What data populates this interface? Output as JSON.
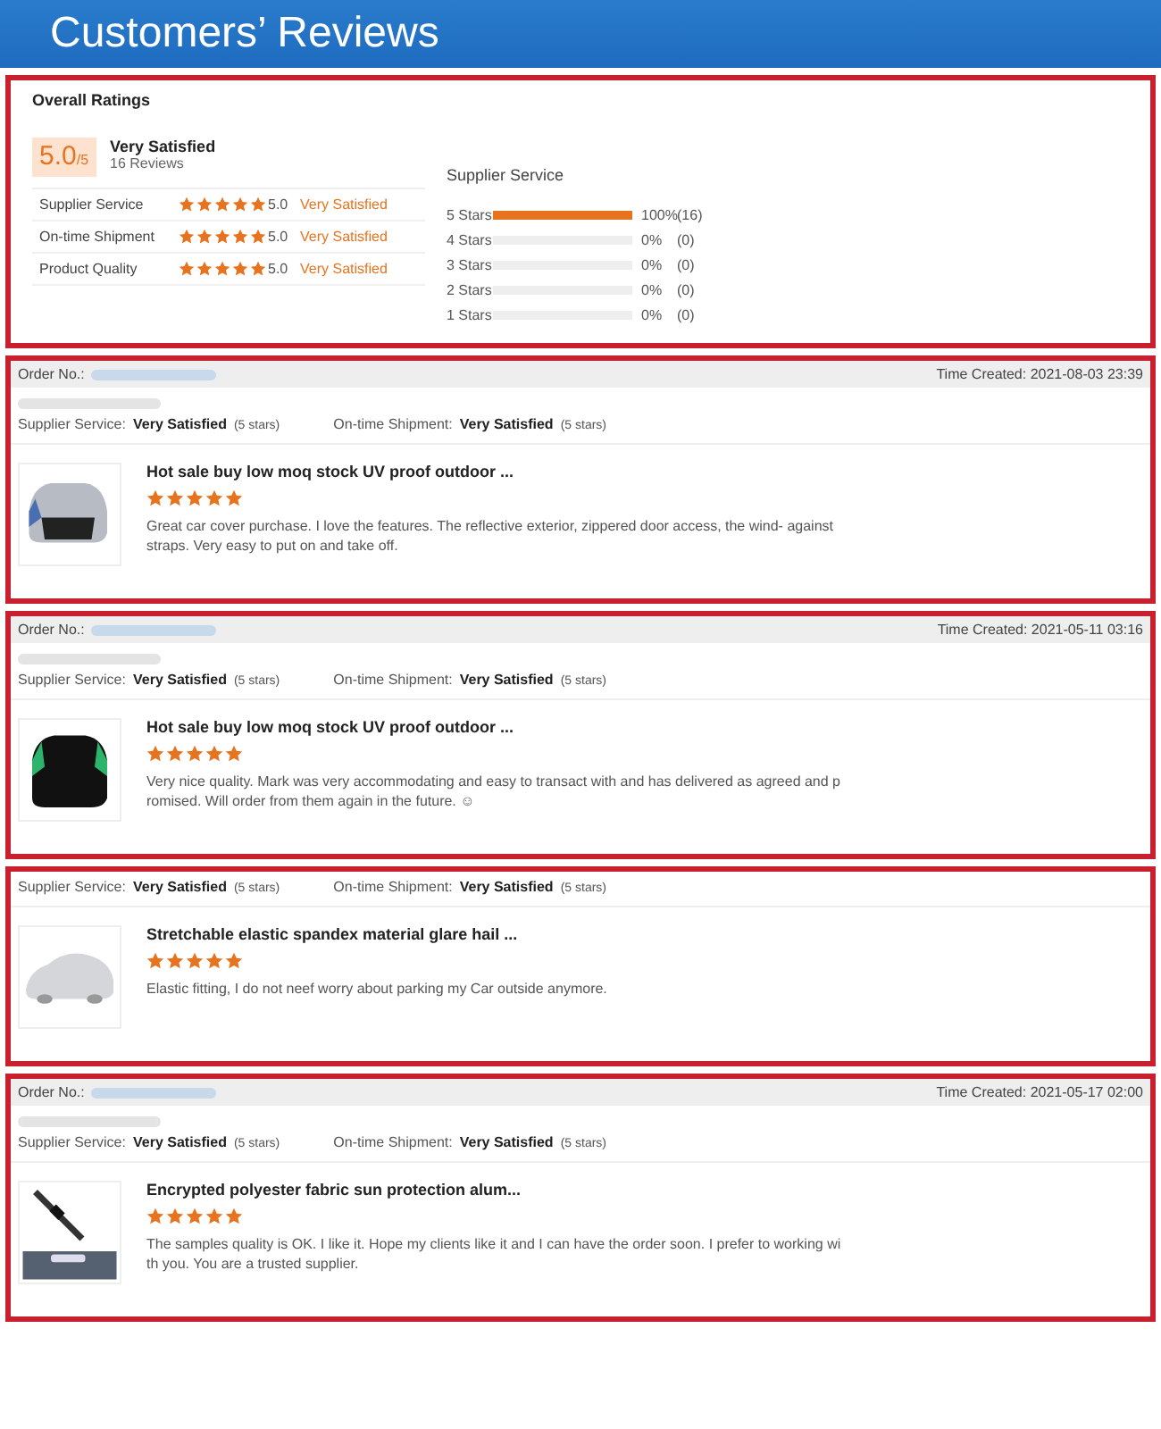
{
  "banner": {
    "title": "Customers’ Reviews"
  },
  "overall": {
    "title": "Overall Ratings",
    "score": "5.0",
    "score_suffix": "/5",
    "verdict": "Very Satisfied",
    "reviews": "16 Reviews",
    "ratings": [
      {
        "label": "Supplier Service",
        "stars": 5,
        "score": "5.0",
        "verdict": "Very Satisfied"
      },
      {
        "label": "On-time Shipment",
        "stars": 5,
        "score": "5.0",
        "verdict": "Very Satisfied"
      },
      {
        "label": "Product Quality",
        "stars": 5,
        "score": "5.0",
        "verdict": "Very Satisfied"
      }
    ],
    "distribution_title": "Supplier Service",
    "distribution": [
      {
        "label": "5 Stars",
        "level": 1,
        "percent": "100%",
        "count": "(16)"
      },
      {
        "label": "4 Stars",
        "level": 0,
        "percent": "0%",
        "count": "(0)"
      },
      {
        "label": "3 Stars",
        "level": 0,
        "percent": "0%",
        "count": "(0)"
      },
      {
        "label": "2 Stars",
        "level": 0,
        "percent": "0%",
        "count": "(0)"
      },
      {
        "label": "1 Stars",
        "level": 0,
        "percent": "0%",
        "count": "(0)"
      }
    ]
  },
  "reviews": [
    {
      "order_label": "Order No.:",
      "time_created": "Time Created: 2021-08-03 23:39",
      "ratings": [
        {
          "label": "Supplier Service:",
          "value": "Very Satisfied",
          "stars_text": "(5 stars)"
        },
        {
          "label": "On-time Shipment:",
          "value": "Very Satisfied",
          "stars_text": "(5 stars)"
        }
      ],
      "product": "Hot sale buy low moq stock UV proof outdoor ...",
      "thumbnail": {
        "kind": "grey-cover"
      },
      "stars": 5,
      "comment": "Great car cover purchase. I love the features. The reflective exterior, zippered door access, the wind- against straps. Very easy to put on and take off."
    },
    {
      "order_label": "Order No.:",
      "time_created": "Time Created: 2021-05-11 03:16",
      "ratings": [
        {
          "label": "Supplier Service:",
          "value": "Very Satisfied",
          "stars_text": "(5 stars)"
        },
        {
          "label": "On-time Shipment:",
          "value": "Very Satisfied",
          "stars_text": "(5 stars)"
        }
      ],
      "product": "Hot sale buy low moq stock UV proof outdoor ...",
      "thumbnail": {
        "kind": "black-cover"
      },
      "stars": 5,
      "comment": "Very nice quality. Mark was very accommodating and easy to transact with and has delivered as agreed and promised. Will order from them again in the future. ☺"
    },
    {
      "ratings": [
        {
          "label": "Supplier Service:",
          "value": "Very Satisfied",
          "stars_text": "(5 stars)"
        },
        {
          "label": "On-time Shipment:",
          "value": "Very Satisfied",
          "stars_text": "(5 stars)"
        }
      ],
      "product": "Stretchable elastic spandex material glare hail ...",
      "thumbnail": {
        "kind": "silver-cover"
      },
      "stars": 5,
      "comment": "Elastic  fitting, I do not neef worry about parking my Car outside anymore."
    },
    {
      "order_label": "Order No.:",
      "time_created": "Time Created: 2021-05-17 02:00",
      "ratings": [
        {
          "label": "Supplier Service:",
          "value": "Very Satisfied",
          "stars_text": "(5 stars)"
        },
        {
          "label": "On-time Shipment:",
          "value": "Very Satisfied",
          "stars_text": "(5 stars)"
        }
      ],
      "product": "Encrypted polyester fabric sun protection alum...",
      "thumbnail": {
        "kind": "sunshade"
      },
      "stars": 5,
      "comment": "The samples quality is OK. I like it. Hope my clients like it and I can have the order soon. I prefer to working with you. You are a trusted supplier."
    }
  ]
}
